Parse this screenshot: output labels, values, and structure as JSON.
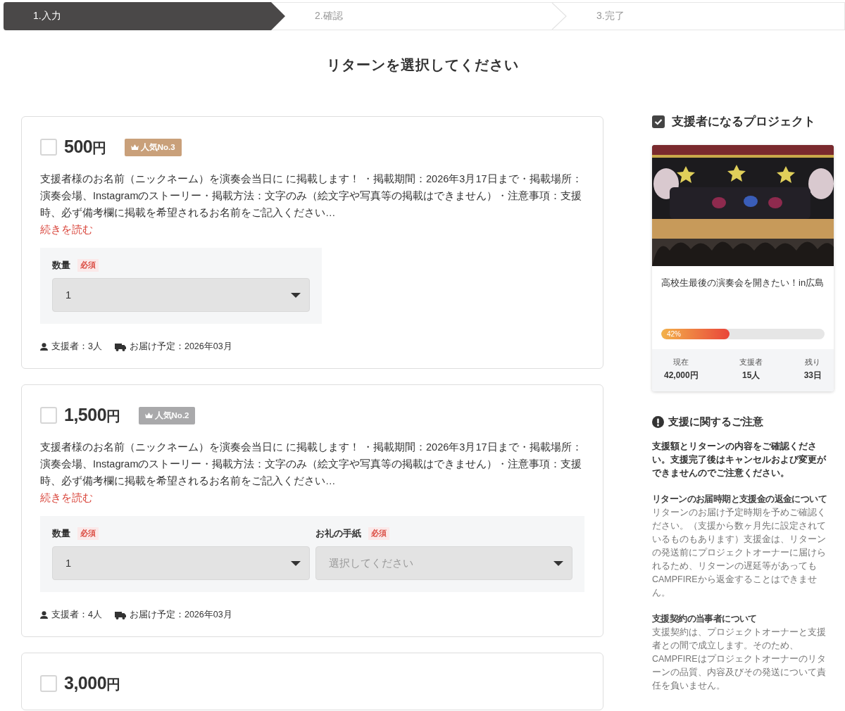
{
  "steps": [
    {
      "label": "1.入力",
      "selected": true
    },
    {
      "label": "2.確認",
      "selected": false
    },
    {
      "label": "3.完了",
      "selected": false
    }
  ],
  "heading": "リターンを選択してください",
  "rewards": [
    {
      "checked": false,
      "price": "500",
      "currency": "円",
      "badge": {
        "label": "人気No.3",
        "color": "#c9a07a"
      },
      "description": "支援者様のお名前（ニックネーム）を演奏会当日に に掲載します！ ・掲載期間：2026年3月17日まで・掲載場所：演奏会場、Instagramのストーリー・掲載方法：文字のみ（絵文字や写真等の掲載はできません）・注意事項：支援時、必ず備考欄に掲載を希望されるお名前をご記入ください…",
      "read_more": "続きを読む",
      "fields": [
        {
          "label": "数量",
          "required": "必須",
          "value": "1"
        }
      ],
      "supporters": "支援者：3人",
      "delivery": "お届け予定：2026年03月"
    },
    {
      "checked": false,
      "price": "1,500",
      "currency": "円",
      "badge": {
        "label": "人気No.2",
        "color": "#a9a9ab"
      },
      "description": "支援者様のお名前（ニックネーム）を演奏会当日に に掲載します！ ・掲載期間：2026年3月17日まで・掲載場所：演奏会場、Instagramのストーリー・掲載方法：文字のみ（絵文字や写真等の掲載はできません）・注意事項：支援時、必ず備考欄に掲載を希望されるお名前をご記入ください…",
      "read_more": "続きを読む",
      "fields": [
        {
          "label": "数量",
          "required": "必須",
          "value": "1"
        },
        {
          "label": "お礼の手紙",
          "required": "必須",
          "placeholder": "選択してください"
        }
      ],
      "supporters": "支援者：4人",
      "delivery": "お届け予定：2026年03月"
    },
    {
      "checked": false,
      "price": "3,000",
      "currency": "円"
    }
  ],
  "sidebar": {
    "project_heading": "支援者になるプロジェクト",
    "project": {
      "title": "高校生最後の演奏会を開きたい！in広島",
      "progress": {
        "level": 0.42,
        "label": "42%"
      },
      "stats": [
        {
          "label": "現在",
          "value": "42,000円"
        },
        {
          "label": "支援者",
          "value": "15人"
        },
        {
          "label": "残り",
          "value": "33日"
        }
      ]
    },
    "notice": {
      "heading": "支援に関するご注意",
      "lead": "支援額とリターンの内容をご確認ください。支援完了後はキャンセルおよび変更ができませんのでご注意ください。",
      "sections": [
        {
          "title": "リターンのお届時期と支援金の返金について",
          "body": "リターンのお届け予定時期を予めご確認ください。（支援から数ヶ月先に設定されているものもあります）支援金は、リターンの発送前にプロジェクトオーナーに届けられるため、リターンの遅延等があってもCAMPFIREから返金することはできません。"
        },
        {
          "title": "支援契約の当事者について",
          "body": "支援契約は、プロジェクトオーナーと支援者との間で成立します。そのため、CAMPFIREはプロジェクトオーナーのリターンの品質、内容及びその発送について責任を負いません。"
        }
      ]
    }
  }
}
